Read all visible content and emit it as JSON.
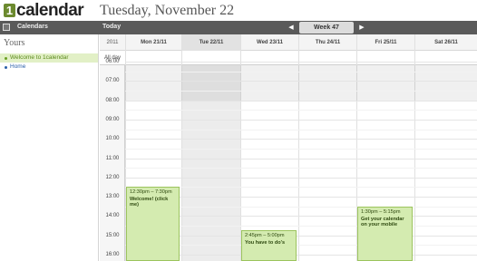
{
  "header": {
    "logo_mark": "1",
    "logo_text": "calendar",
    "date_title": "Tuesday, November 22"
  },
  "toolbar": {
    "calendars_label": "Calendars",
    "today_label": "Today",
    "prev_icon": "◀",
    "week_label": "Week 47",
    "next_icon": "▶"
  },
  "sidebar": {
    "title": "Yours",
    "items": [
      {
        "label": "Welcome to 1calendar",
        "color": "#6aa022",
        "selected": true
      },
      {
        "label": "Home",
        "color": "#2a5fa8",
        "selected": false
      }
    ]
  },
  "calendar": {
    "year": "2011",
    "days": [
      {
        "label": "Mon 21/11",
        "today": false
      },
      {
        "label": "Tue 22/11",
        "today": true
      },
      {
        "label": "Wed 23/11",
        "today": false
      },
      {
        "label": "Thu 24/11",
        "today": false
      },
      {
        "label": "Fri 25/11",
        "today": false
      },
      {
        "label": "Sat 26/11",
        "today": false
      }
    ],
    "allday_label": "All day",
    "times": [
      "06:00",
      "07:00",
      "08:00",
      "09:00",
      "10:00",
      "11:00",
      "12:00",
      "13:00",
      "14:00",
      "15:00",
      "16:00"
    ],
    "events": [
      {
        "day": 0,
        "start": 12.5,
        "end": 19.5,
        "time": "12:30pm – 7:30pm",
        "title": "Welcome! (click me)"
      },
      {
        "day": 2,
        "start": 14.75,
        "end": 17.0,
        "time": "2:45pm – 5:00pm",
        "title": "You have to do's"
      },
      {
        "day": 4,
        "start": 13.5,
        "end": 17.25,
        "time": "1:30pm – 5:15pm",
        "title": "Get your calendar on your mobile"
      }
    ]
  },
  "colors": {
    "accent_green": "#6aa022",
    "event_bg": "#d4ebb0",
    "toolbar_bg": "#5a5a5a",
    "link_blue": "#2a5fa8"
  }
}
